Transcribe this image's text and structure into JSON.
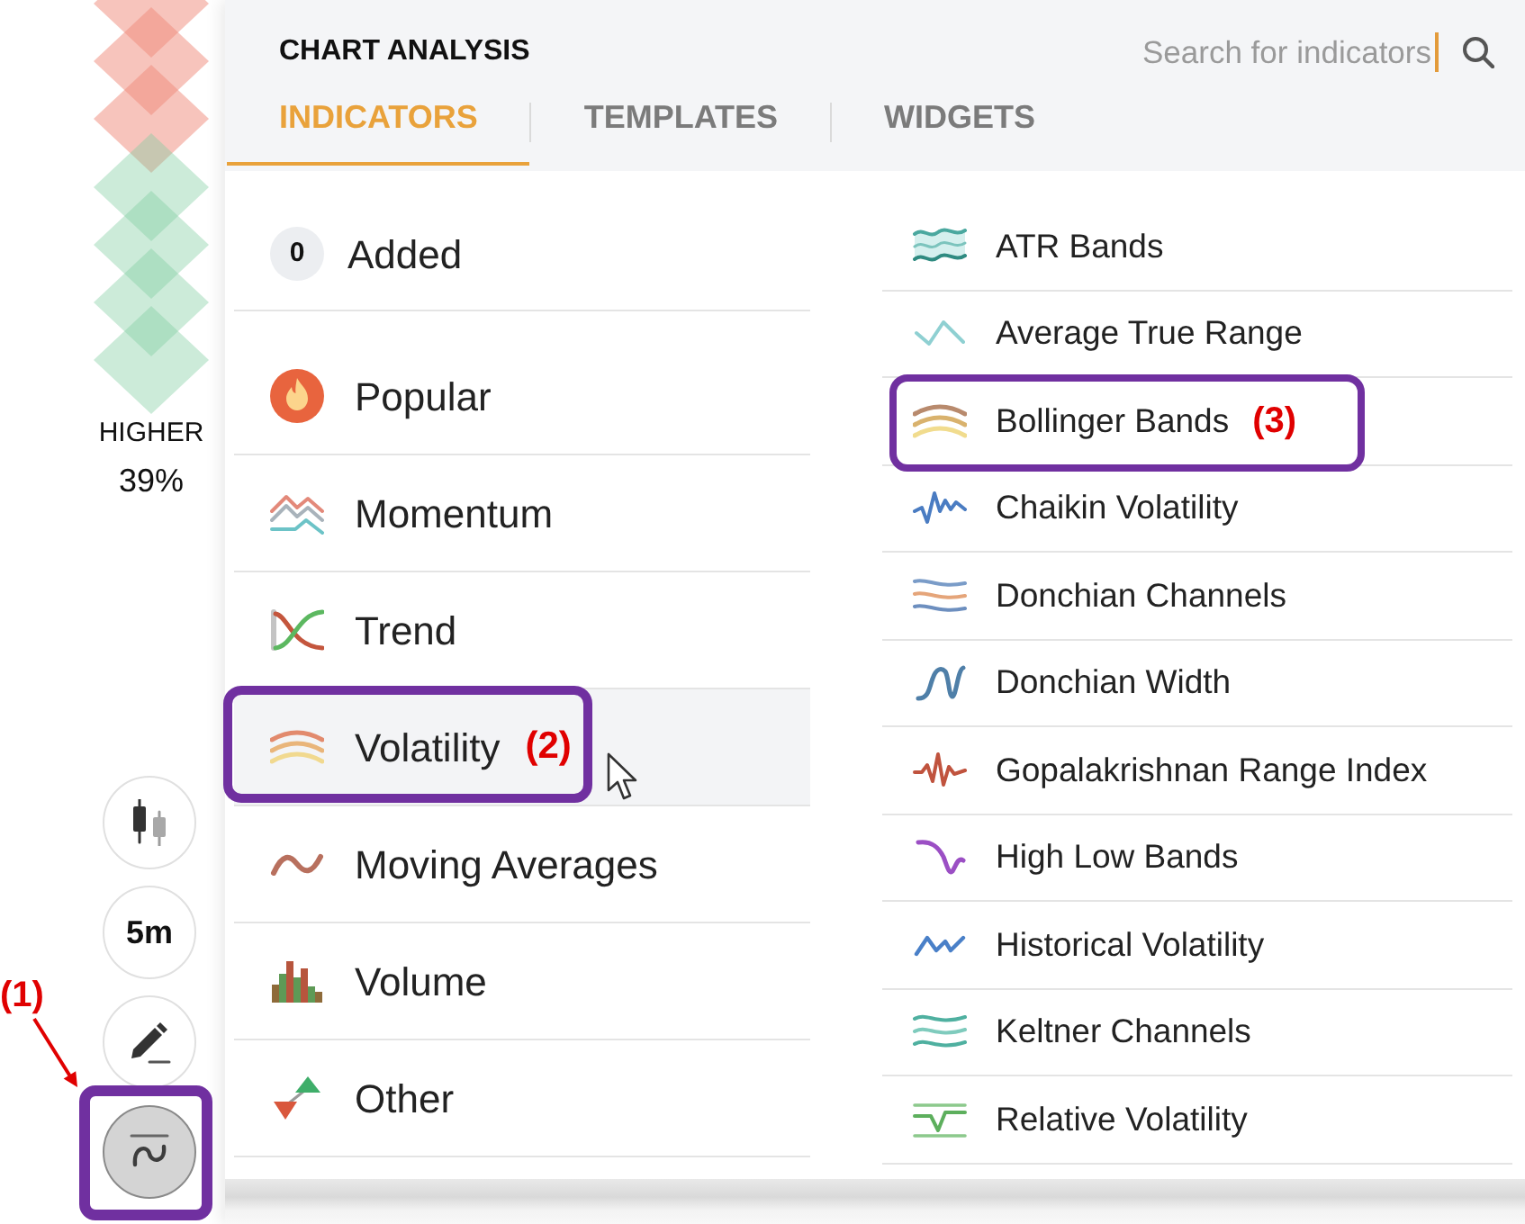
{
  "sentiment": {
    "label": "HIGHER",
    "value": "39%"
  },
  "toolbar": [
    {
      "selected": false
    },
    {
      "label": "5m",
      "selected": false
    },
    {
      "selected": false
    },
    {
      "selected": true,
      "callout": "(1)"
    }
  ],
  "panel": {
    "title": "CHART ANALYSIS",
    "search": {
      "placeholder": "Search for indicators",
      "focused": true
    },
    "tabs": [
      {
        "label": "INDICATORS",
        "selected": true
      },
      {
        "label": "TEMPLATES",
        "selected": false
      },
      {
        "label": "WIDGETS",
        "selected": false
      }
    ]
  },
  "added": {
    "count": "0",
    "label": "Added"
  },
  "categories": [
    {
      "label": "Popular",
      "selected": false
    },
    {
      "label": "Momentum",
      "selected": false
    },
    {
      "label": "Trend",
      "selected": false
    },
    {
      "label": "Volatility",
      "selected": true,
      "callout": "(2)"
    },
    {
      "label": "Moving Averages",
      "selected": false
    },
    {
      "label": "Volume",
      "selected": false
    },
    {
      "label": "Other",
      "selected": false
    }
  ],
  "indicators": [
    {
      "label": "ATR Bands"
    },
    {
      "label": "Average True Range"
    },
    {
      "label": "Bollinger Bands",
      "callout": "(3)"
    },
    {
      "label": "Chaikin Volatility"
    },
    {
      "label": "Donchian Channels"
    },
    {
      "label": "Donchian Width"
    },
    {
      "label": "Gopalakrishnan Range Index"
    },
    {
      "label": "High Low Bands"
    },
    {
      "label": "Historical Volatility"
    },
    {
      "label": "Keltner Channels"
    },
    {
      "label": "Relative Volatility"
    }
  ]
}
